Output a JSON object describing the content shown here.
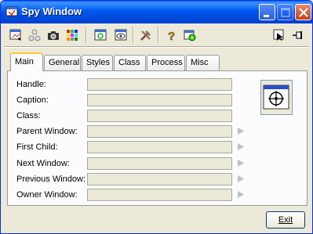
{
  "window": {
    "title": "Spy Window"
  },
  "toolbar": {
    "buttons": [
      "window-list-icon",
      "hierarchy-icon",
      "camera-icon",
      "color-grid-icon",
      "refresh-window-icon",
      "view-window-icon",
      "tools-icon",
      "help-icon",
      "browser-icon",
      "select-cursor-icon",
      "pin-icon"
    ]
  },
  "tabs": [
    {
      "label": "Main",
      "active": true
    },
    {
      "label": "General",
      "active": false
    },
    {
      "label": "Styles",
      "active": false
    },
    {
      "label": "Class",
      "active": false
    },
    {
      "label": "Process",
      "active": false
    },
    {
      "label": "Misc",
      "active": false
    }
  ],
  "fields": [
    {
      "label": "Handle:",
      "value": "",
      "has_arrow": false
    },
    {
      "label": "Caption:",
      "value": "",
      "has_arrow": false
    },
    {
      "label": "Class:",
      "value": "",
      "has_arrow": false
    },
    {
      "label": "Parent Window:",
      "value": "",
      "has_arrow": true
    },
    {
      "label": "First Child:",
      "value": "",
      "has_arrow": true
    },
    {
      "label": "Next Window:",
      "value": "",
      "has_arrow": true
    },
    {
      "label": "Previous Window:",
      "value": "",
      "has_arrow": true
    },
    {
      "label": "Owner Window:",
      "value": "",
      "has_arrow": true
    }
  ],
  "finder_tool": {
    "icon": "crosshair-finder-icon"
  },
  "footer": {
    "exit_label": "Exit"
  },
  "colors": {
    "titlebar": "#0058ee",
    "face": "#ece9d8",
    "tab_highlight": "#ffc83c",
    "close": "#c4421f"
  }
}
